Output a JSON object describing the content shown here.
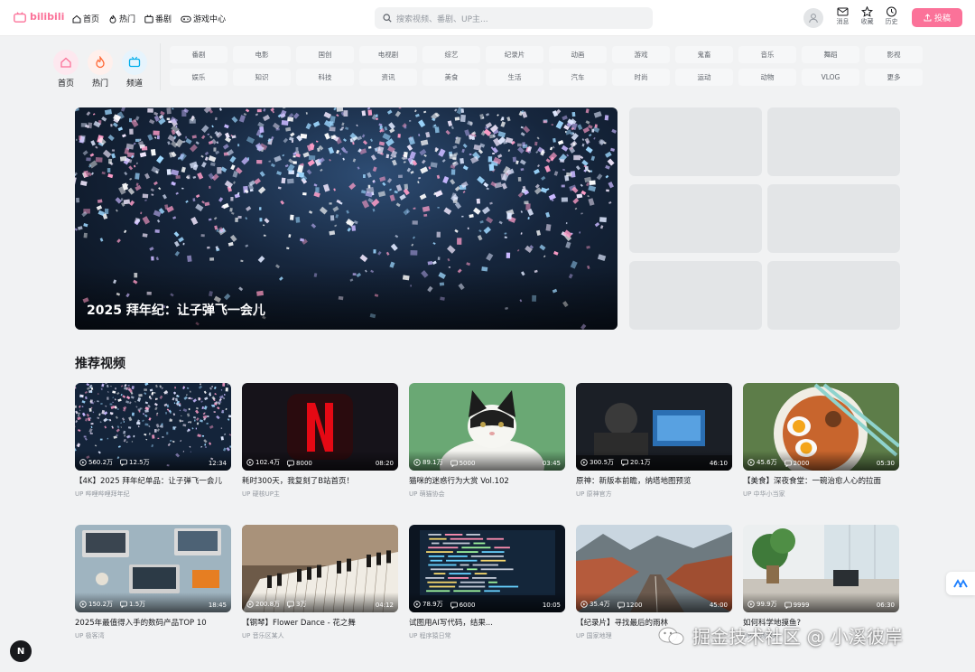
{
  "header": {
    "logo_text": "bilibili",
    "nav": [
      {
        "label": "首页",
        "icon": "home-icon"
      },
      {
        "label": "热门",
        "icon": "flame-icon"
      },
      {
        "label": "番剧",
        "icon": "tv-icon"
      },
      {
        "label": "游戏中心",
        "icon": "gamepad-icon"
      }
    ],
    "search_placeholder": "搜索视频、番剧、UP主...",
    "icons": [
      {
        "label": "消息",
        "icon": "mail-icon"
      },
      {
        "label": "收藏",
        "icon": "star-icon"
      },
      {
        "label": "历史",
        "icon": "clock-icon"
      }
    ],
    "upload_label": "投稿"
  },
  "quick_nav": [
    {
      "label": "首页",
      "icon": "home-icon"
    },
    {
      "label": "热门",
      "icon": "flame-icon"
    },
    {
      "label": "频道",
      "icon": "tv-icon"
    }
  ],
  "categories": [
    "番剧",
    "电影",
    "国创",
    "电视剧",
    "综艺",
    "纪录片",
    "动画",
    "游戏",
    "鬼畜",
    "音乐",
    "舞蹈",
    "影视",
    "娱乐",
    "知识",
    "科技",
    "资讯",
    "美食",
    "生活",
    "汽车",
    "时尚",
    "运动",
    "动物",
    "VLOG",
    "更多"
  ],
  "banner": {
    "title": "2025 拜年纪：让子弹飞一会儿"
  },
  "section_title": "推荐视频",
  "videos": [
    {
      "title": "【4K】2025 拜年纪单品：让子弹飞一会儿",
      "up": "UP 哔哩哔哩拜年纪",
      "views": "560.2万",
      "comments": "12.5万",
      "duration": "12:34",
      "thumb": "confetti"
    },
    {
      "title": "耗时300天，我复刻了B站首页！",
      "up": "UP 硬核UP主",
      "views": "102.4万",
      "comments": "8000",
      "duration": "08:20",
      "thumb": "netflix"
    },
    {
      "title": "猫咪的迷惑行为大赏 Vol.102",
      "up": "UP 萌猫协会",
      "views": "89.1万",
      "comments": "5000",
      "duration": "03:45",
      "thumb": "cat"
    },
    {
      "title": "原神：新版本前瞻，纳塔地图预览",
      "up": "UP 原神官方",
      "views": "300.5万",
      "comments": "20.1万",
      "duration": "46:10",
      "thumb": "gaming"
    },
    {
      "title": "【美食】深夜食堂：一碗治愈人心的拉面",
      "up": "UP 中华小当家",
      "views": "45.6万",
      "comments": "2000",
      "duration": "05:30",
      "thumb": "ramen"
    },
    {
      "title": "2025年最值得入手的数码产品TOP 10",
      "up": "UP 极客湾",
      "views": "150.2万",
      "comments": "1.5万",
      "duration": "18:45",
      "thumb": "desk"
    },
    {
      "title": "【钢琴】Flower Dance - 花之舞",
      "up": "UP 音乐区某人",
      "views": "200.8万",
      "comments": "3万",
      "duration": "04:12",
      "thumb": "piano"
    },
    {
      "title": "试图用AI写代码，结果...",
      "up": "UP 程序猿日常",
      "views": "78.9万",
      "comments": "6000",
      "duration": "10:05",
      "thumb": "code"
    },
    {
      "title": "【纪录片】寻找最后的雨林",
      "up": "UP 国家地理",
      "views": "35.4万",
      "comments": "1200",
      "duration": "45:00",
      "thumb": "canyon"
    },
    {
      "title": "如何科学地摸鱼?",
      "up": "UP 职场达人",
      "views": "99.9万",
      "comments": "9999",
      "duration": "06:30",
      "thumb": "office"
    }
  ],
  "floating": {
    "left_label": "N"
  },
  "watermark": {
    "text": "掘金技术社区 @ 小溪彼岸"
  },
  "colors": {
    "accent": "#fb7299",
    "bg": "#f1f2f3",
    "text": "#18191c",
    "muted": "#9499a0"
  }
}
